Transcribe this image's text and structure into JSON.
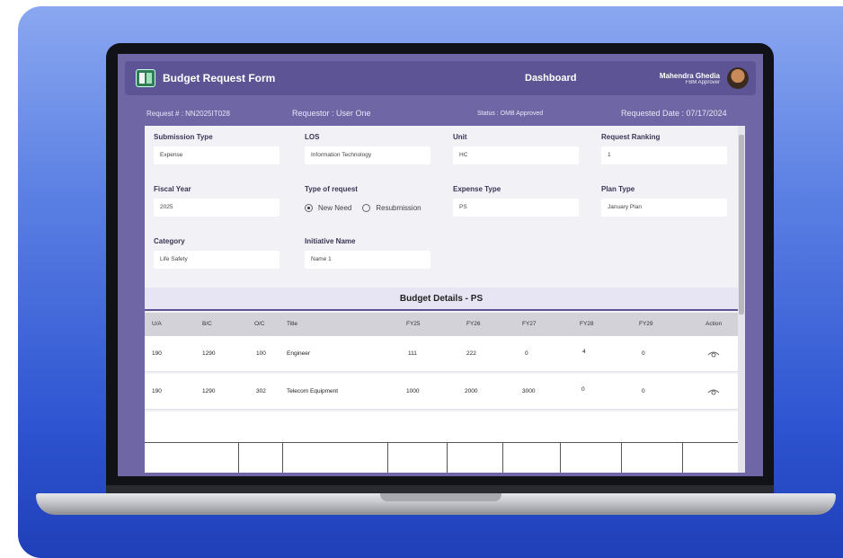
{
  "app": {
    "title": "Budget Request Form",
    "nav": "Dashboard"
  },
  "user": {
    "name": "Mahendra Ghedia",
    "role": "FBM Approver"
  },
  "info": {
    "request": "Request # :  NN2025IT028",
    "requestor": "Requestor :  User One",
    "status": "Status : OMB Approved",
    "date": "Requested Date :  07/17/2024"
  },
  "fields": {
    "submission_type": {
      "label": "Submission Type",
      "value": "Expense"
    },
    "los": {
      "label": "LOS",
      "value": "Information Technology"
    },
    "unit": {
      "label": "Unit",
      "value": "HC"
    },
    "ranking": {
      "label": "Request Ranking",
      "value": "1"
    },
    "fiscal_year": {
      "label": "Fiscal Year",
      "value": "2025"
    },
    "type_of_request": {
      "label": "Type of request",
      "options": [
        "New Need",
        "Resubmission"
      ],
      "selected": "New Need"
    },
    "expense_type": {
      "label": "Expense Type",
      "value": "PS"
    },
    "plan_type": {
      "label": "Plan Type",
      "value": "January Plan"
    },
    "category": {
      "label": "Category",
      "value": "Life Safety"
    },
    "initiative": {
      "label": "Initiative Name",
      "value": "Name 1"
    }
  },
  "budget": {
    "title": "Budget Details - PS",
    "columns": [
      "U/A",
      "B/C",
      "O/C",
      "Title",
      "FY25",
      "FY26",
      "FY27",
      "FY28",
      "FY29",
      "Action"
    ],
    "rows": [
      [
        "190",
        "1290",
        "100",
        "Engineer",
        "111",
        "222",
        "0",
        "4",
        "0"
      ],
      [
        "190",
        "1290",
        "302",
        "Telecom Equipment",
        "1000",
        "2000",
        "3000",
        "0",
        "0"
      ]
    ],
    "action_icon": "eye-icon"
  }
}
